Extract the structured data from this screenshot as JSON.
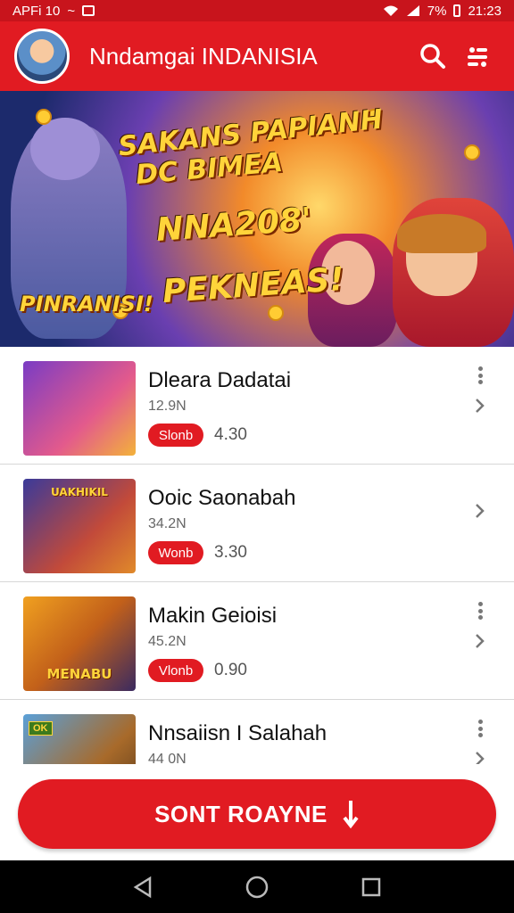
{
  "status_bar": {
    "left_text": "APFi 10",
    "battery": "7%",
    "time": "21:23"
  },
  "app_bar": {
    "title": "Nndamgai INDANISIA",
    "icons": [
      "avatar",
      "search-icon",
      "menu-icon"
    ]
  },
  "banner": {
    "lines": [
      "SAKANS PAPIANH",
      "DC BIMEA",
      "NNA208'",
      "PINRANISI!",
      "PEKNEAS!"
    ]
  },
  "list": [
    {
      "title": "Dleara Dadatai",
      "subtitle": "12.9N",
      "badge": "Slonb",
      "rating": "4.30",
      "thumb_text": "",
      "thumb_colors": [
        "#7a3cc4",
        "#e35a8c"
      ],
      "show_more": true
    },
    {
      "title": "Ooic Saonabah",
      "subtitle": "34.2N",
      "badge": "Wonb",
      "rating": "3.30",
      "thumb_text": "UAKHIKIL",
      "thumb_colors": [
        "#3a3a9a",
        "#c24a3a"
      ],
      "show_more": false
    },
    {
      "title": "Makin Geioisi",
      "subtitle": "45.2N",
      "badge": "Vlonb",
      "rating": "0.90",
      "thumb_text": "MENABU",
      "thumb_colors": [
        "#f0a020",
        "#3a2a60"
      ],
      "show_more": true
    },
    {
      "title": "Nnsaiisn I Salahah",
      "subtitle": "44 0N",
      "badge": "",
      "rating": "",
      "thumb_text": "OK",
      "thumb_colors": [
        "#5aa0d8",
        "#a86a2a"
      ],
      "show_more": true
    }
  ],
  "cta": {
    "label": "SONT ROAYNE"
  },
  "colors": {
    "primary": "#e11b22",
    "status": "#c8141c",
    "nav": "#000000"
  }
}
